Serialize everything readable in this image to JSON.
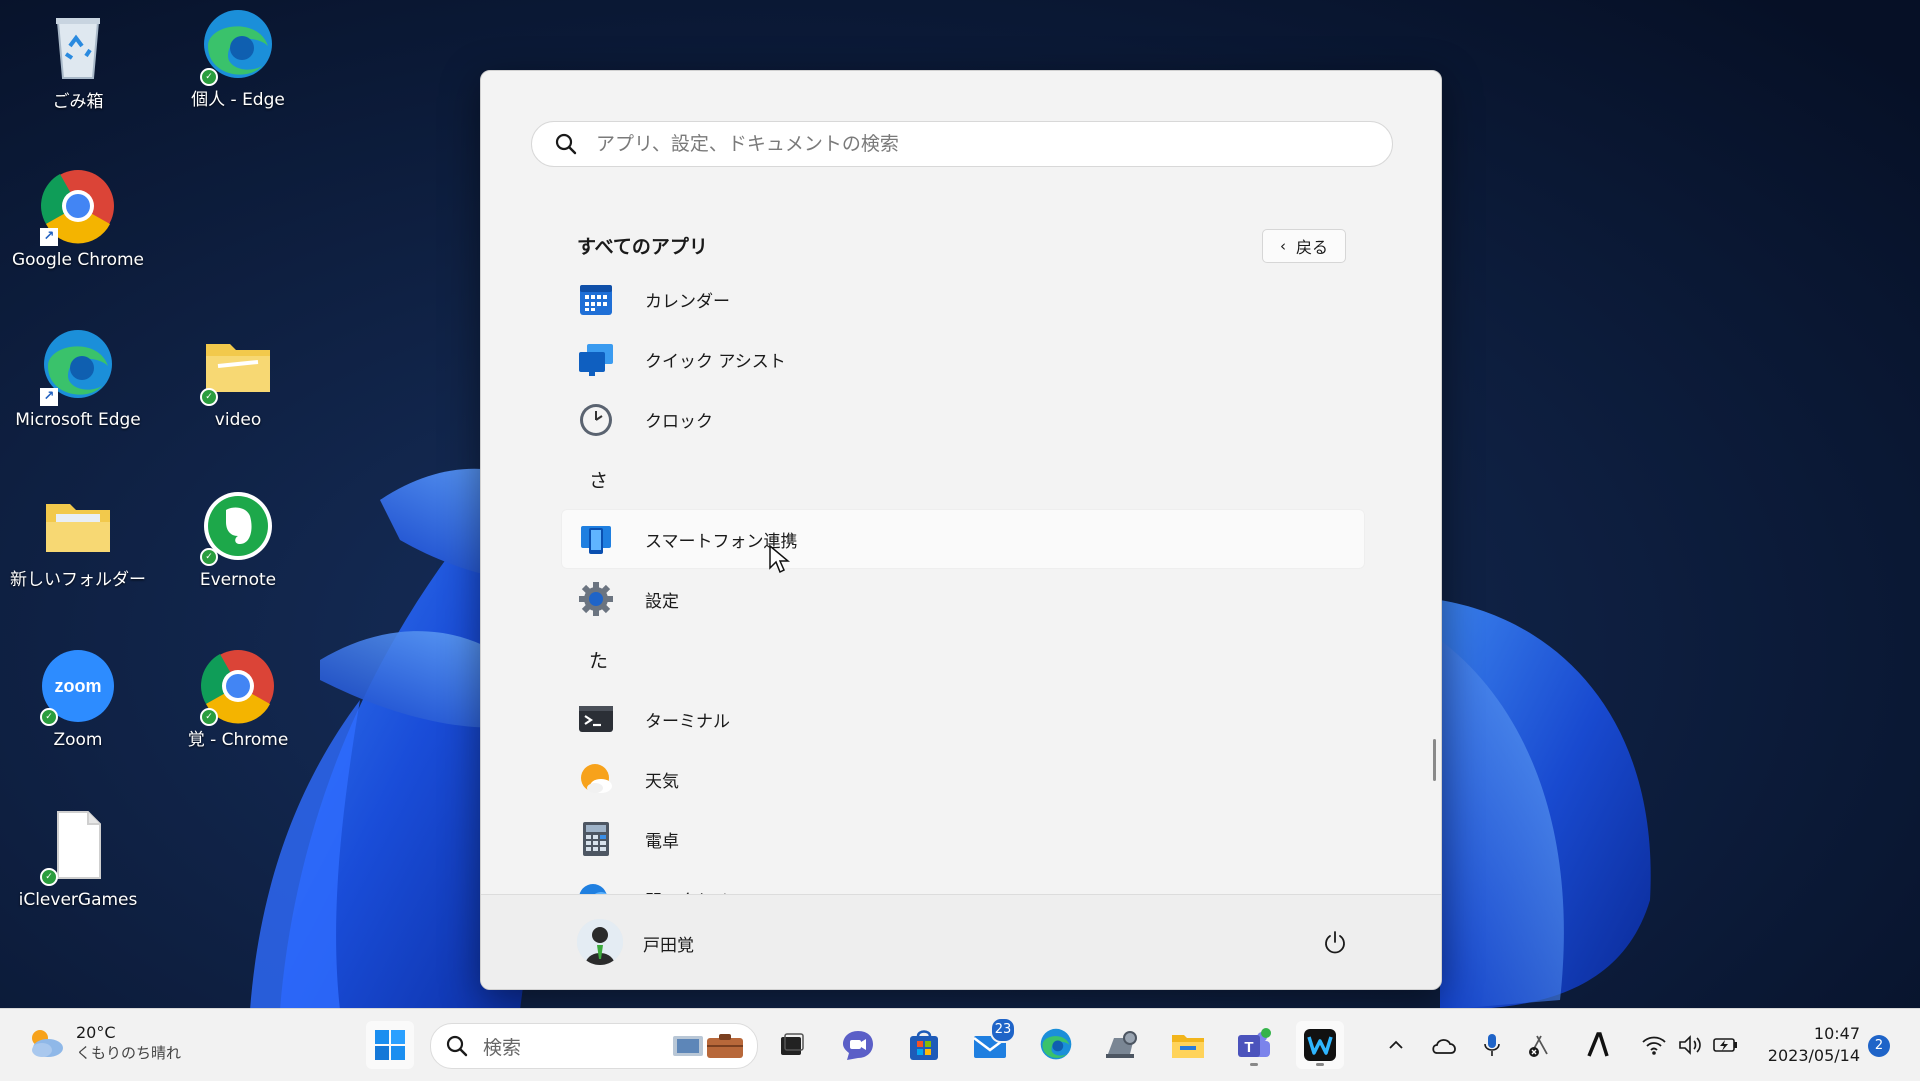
{
  "desktop": {
    "icons": [
      {
        "label": "ごみ箱",
        "icon": "recycle-bin-icon"
      },
      {
        "label": "個人 - Edge",
        "icon": "edge-icon"
      },
      {
        "label": "Google Chrome",
        "icon": "chrome-icon"
      },
      {
        "label": "Microsoft Edge",
        "icon": "edge-icon"
      },
      {
        "label": "video",
        "icon": "folder-icon"
      },
      {
        "label": "新しいフォルダー",
        "icon": "folder-icon"
      },
      {
        "label": "Evernote",
        "icon": "evernote-icon"
      },
      {
        "label": "Zoom",
        "icon": "zoom-icon"
      },
      {
        "label": "覚 - Chrome",
        "icon": "chrome-icon"
      },
      {
        "label": "iCleverGames",
        "icon": "file-icon"
      }
    ]
  },
  "start_menu": {
    "search_placeholder": "アプリ、設定、ドキュメントの検索",
    "section_title": "すべてのアプリ",
    "back_label": "戻る",
    "apps": [
      {
        "label": "カレンダー",
        "icon": "calendar-icon"
      },
      {
        "label": "クイック アシスト",
        "icon": "quick-assist-icon"
      },
      {
        "label": "クロック",
        "icon": "clock-icon"
      },
      {
        "letter": "さ"
      },
      {
        "label": "スマートフォン連携",
        "icon": "phone-link-icon"
      },
      {
        "label": "設定",
        "icon": "settings-icon"
      },
      {
        "letter": "た"
      },
      {
        "label": "ターミナル",
        "icon": "terminal-icon"
      },
      {
        "label": "天気",
        "icon": "weather-icon"
      },
      {
        "label": "電卓",
        "icon": "calculator-icon"
      },
      {
        "label": "問い合わせ",
        "icon": "get-help-icon"
      }
    ],
    "user_name": "戸田覚"
  },
  "taskbar": {
    "weather_temp": "20°C",
    "weather_condition": "くもりのち晴れ",
    "search_label": "検索",
    "mail_badge": "23",
    "clock_time": "10:47",
    "clock_date": "2023/05/14",
    "notification_count": "2"
  },
  "colors": {
    "accent": "#1f64c8",
    "wallpaper": "#0a1a3a"
  }
}
